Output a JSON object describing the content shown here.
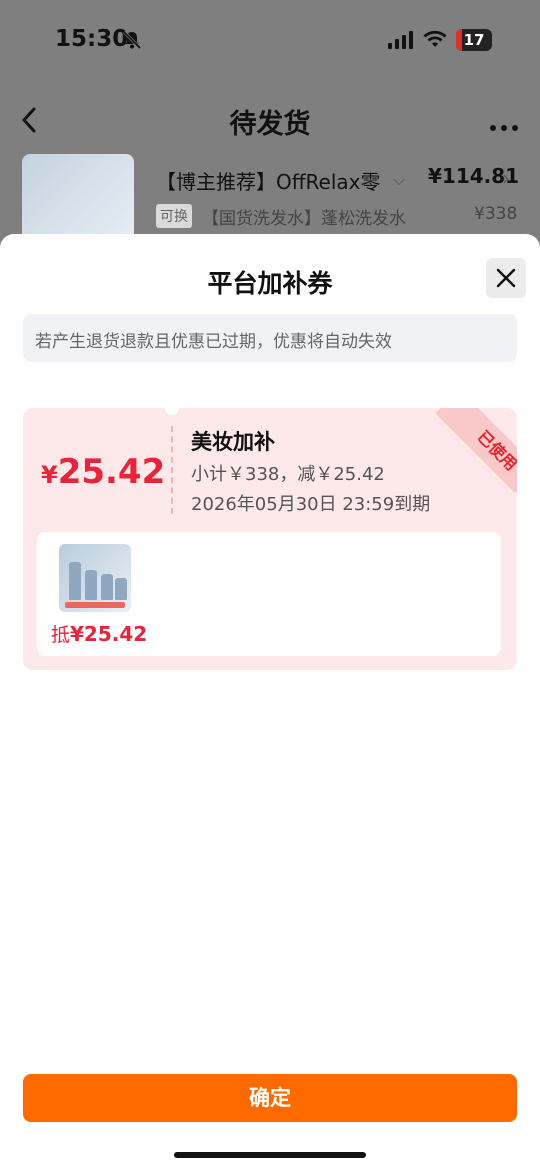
{
  "status_bar": {
    "time": "15:30",
    "battery": "17"
  },
  "nav": {
    "title": "待发货"
  },
  "order": {
    "title": "【博主推荐】OffRelax零",
    "price": "¥114.81",
    "swap_tag": "可换",
    "sub_title": "【国货洗发水】蓬松洗发水",
    "sub_price": "¥338"
  },
  "sheet": {
    "title": "平台加补券",
    "notice": "若产生退货退款且优惠已过期，优惠将自动失效",
    "confirm_label": "确定"
  },
  "coupon": {
    "currency": "¥",
    "amount": "25.42",
    "name": "美妆加补",
    "subtotal": "小计￥338，减￥25.42",
    "expire": "2026年05月30日 23:59到期",
    "used_stamp": "已使用",
    "deduct_label": "抵",
    "deduct_amount": "¥25.42"
  },
  "colors": {
    "accent": "#ff6a00",
    "coupon_red": "#e6243c",
    "coupon_bg": "#fde9e9"
  }
}
